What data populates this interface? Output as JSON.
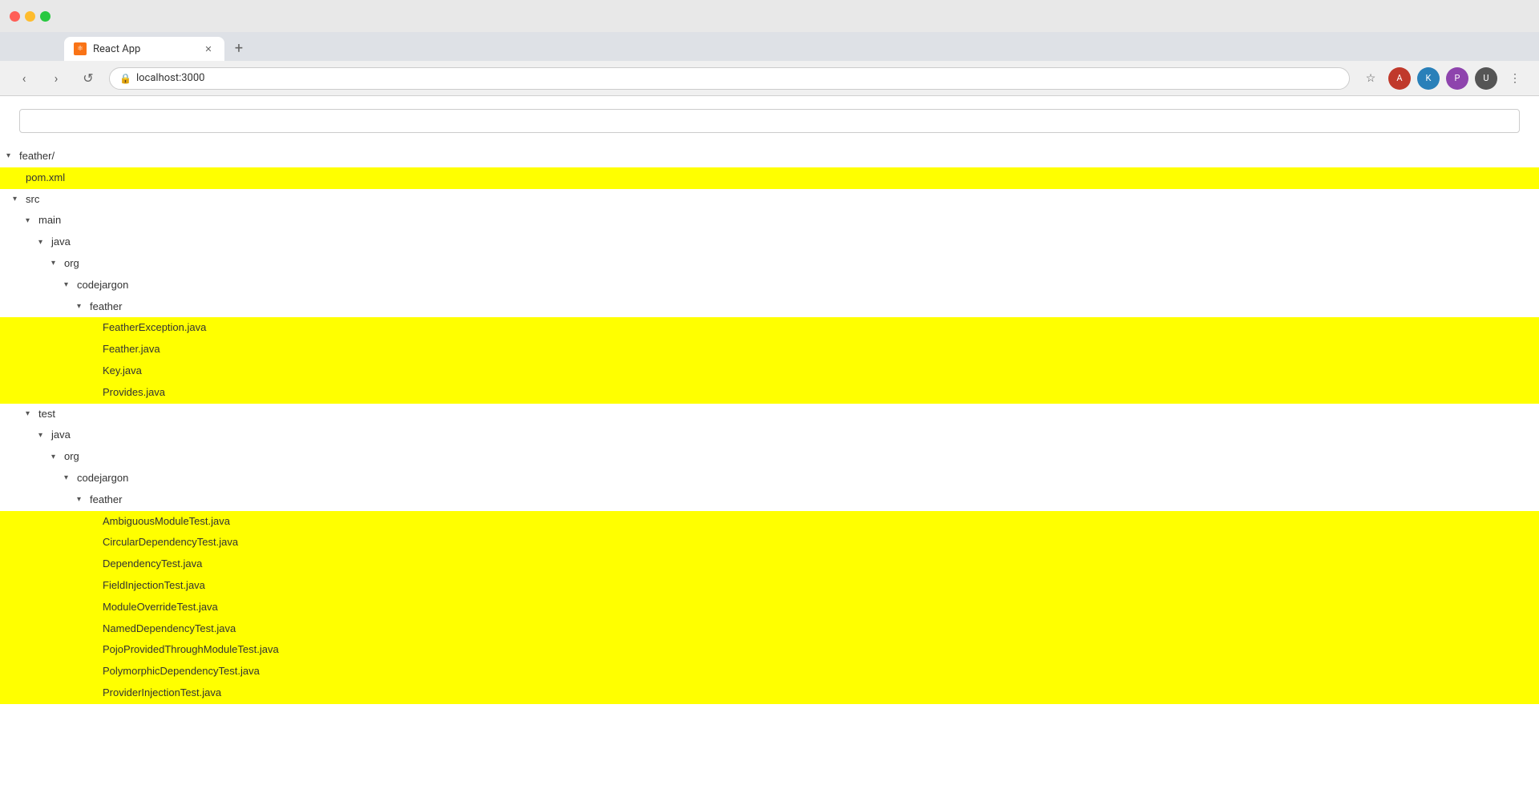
{
  "browser": {
    "tab_title": "React App",
    "url": "localhost:3000",
    "new_tab_label": "+",
    "nav": {
      "back": "‹",
      "forward": "›",
      "reload": "↺"
    }
  },
  "page": {
    "search_placeholder": ""
  },
  "tree": {
    "root": "feather/",
    "items": [
      {
        "id": "pom-xml",
        "label": "pom.xml",
        "type": "file",
        "indent": 16,
        "highlighted": true
      },
      {
        "id": "src",
        "label": "src",
        "type": "folder",
        "indent": 16,
        "expanded": true
      },
      {
        "id": "main",
        "label": "main",
        "type": "folder",
        "indent": 32,
        "expanded": true
      },
      {
        "id": "java-main",
        "label": "java",
        "type": "folder",
        "indent": 48,
        "expanded": true
      },
      {
        "id": "org-main",
        "label": "org",
        "type": "folder",
        "indent": 64,
        "expanded": true
      },
      {
        "id": "codejargon-main",
        "label": "codejargon",
        "type": "folder",
        "indent": 80,
        "expanded": true
      },
      {
        "id": "feather-main",
        "label": "feather",
        "type": "folder",
        "indent": 96,
        "expanded": true
      },
      {
        "id": "feather-exception-java",
        "label": "FeatherException.java",
        "type": "file",
        "indent": 112,
        "highlighted": true
      },
      {
        "id": "feather-java",
        "label": "Feather.java",
        "type": "file",
        "indent": 112,
        "highlighted": true
      },
      {
        "id": "key-java",
        "label": "Key.java",
        "type": "file",
        "indent": 112,
        "highlighted": true
      },
      {
        "id": "provides-java",
        "label": "Provides.java",
        "type": "file",
        "indent": 112,
        "highlighted": true
      },
      {
        "id": "test",
        "label": "test",
        "type": "folder",
        "indent": 32,
        "expanded": true
      },
      {
        "id": "java-test",
        "label": "java",
        "type": "folder",
        "indent": 48,
        "expanded": true
      },
      {
        "id": "org-test",
        "label": "org",
        "type": "folder",
        "indent": 64,
        "expanded": true
      },
      {
        "id": "codejargon-test",
        "label": "codejargon",
        "type": "folder",
        "indent": 80,
        "expanded": true
      },
      {
        "id": "feather-test",
        "label": "feather",
        "type": "folder",
        "indent": 96,
        "expanded": true
      },
      {
        "id": "ambiguous-module-test",
        "label": "AmbiguousModuleTest.java",
        "type": "file",
        "indent": 112,
        "highlighted": true
      },
      {
        "id": "circular-dependency-test",
        "label": "CircularDependencyTest.java",
        "type": "file",
        "indent": 112,
        "highlighted": true
      },
      {
        "id": "dependency-test",
        "label": "DependencyTest.java",
        "type": "file",
        "indent": 112,
        "highlighted": true
      },
      {
        "id": "field-injection-test",
        "label": "FieldInjectionTest.java",
        "type": "file",
        "indent": 112,
        "highlighted": true
      },
      {
        "id": "module-override-test",
        "label": "ModuleOverrideTest.java",
        "type": "file",
        "indent": 112,
        "highlighted": true
      },
      {
        "id": "named-dependency-test",
        "label": "NamedDependencyTest.java",
        "type": "file",
        "indent": 112,
        "highlighted": true
      },
      {
        "id": "pojo-provided-test",
        "label": "PojoProvidedThroughModuleTest.java",
        "type": "file",
        "indent": 112,
        "highlighted": true
      },
      {
        "id": "polymorphic-dependency-test",
        "label": "PolymorphicDependencyTest.java",
        "type": "file",
        "indent": 112,
        "highlighted": true
      },
      {
        "id": "provider-injection-test",
        "label": "ProviderInjectionTest.java",
        "type": "file",
        "indent": 112,
        "highlighted": true
      }
    ]
  },
  "colors": {
    "highlight": "#ffff00",
    "text": "#333333",
    "muted": "#666666"
  }
}
